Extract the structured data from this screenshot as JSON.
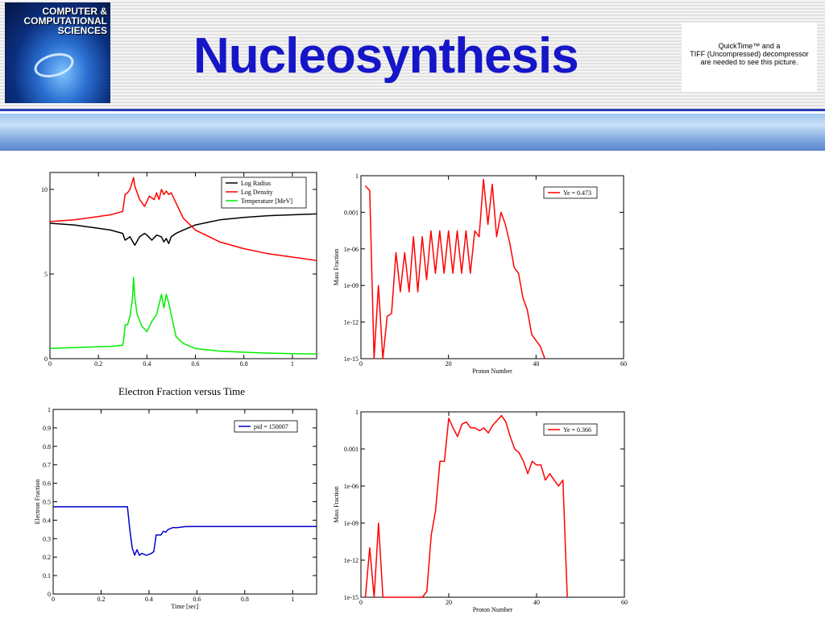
{
  "logo": {
    "lines": [
      "COMPUTER &",
      "COMPUTATIONAL",
      "SCIENCES"
    ]
  },
  "title": "Nucleosynthesis",
  "quicktime": {
    "lines": [
      "QuickTime™ and a",
      "TIFF (Uncompressed) decompressor",
      "are needed to see this picture."
    ]
  },
  "chart_data": [
    {
      "type": "line",
      "title": "",
      "xlabel": "",
      "ylabel": "",
      "xlim": [
        0,
        1.1
      ],
      "ylim": [
        0,
        11
      ],
      "x_ticks": [
        0,
        0.2,
        0.4,
        0.6,
        0.8,
        1
      ],
      "x_tick_labels": [
        "0",
        "0.2",
        "0.4",
        "0.6",
        "0.8",
        "1"
      ],
      "y_ticks": [
        0,
        5,
        10
      ],
      "y_tick_labels": [
        "0",
        "5",
        "10"
      ],
      "legend": "top-right",
      "series": [
        {
          "name": "Log Radius",
          "color": "#000000",
          "x": [
            0,
            0.1,
            0.2,
            0.25,
            0.3,
            0.31,
            0.32,
            0.33,
            0.35,
            0.37,
            0.39,
            0.4,
            0.42,
            0.44,
            0.46,
            0.47,
            0.48,
            0.49,
            0.5,
            0.52,
            0.55,
            0.6,
            0.7,
            0.8,
            0.9,
            1.0,
            1.1
          ],
          "y": [
            8.0,
            7.9,
            7.7,
            7.6,
            7.4,
            7.0,
            7.1,
            7.2,
            6.7,
            7.2,
            7.4,
            7.3,
            7.0,
            7.3,
            7.2,
            6.9,
            7.1,
            6.8,
            7.2,
            7.4,
            7.6,
            7.9,
            8.2,
            8.35,
            8.45,
            8.5,
            8.55
          ]
        },
        {
          "name": "Log Density",
          "color": "#ff0000",
          "x": [
            0,
            0.1,
            0.2,
            0.25,
            0.3,
            0.31,
            0.32,
            0.33,
            0.345,
            0.35,
            0.37,
            0.39,
            0.41,
            0.43,
            0.44,
            0.45,
            0.46,
            0.47,
            0.48,
            0.49,
            0.5,
            0.52,
            0.55,
            0.6,
            0.7,
            0.8,
            0.9,
            1.0,
            1.1
          ],
          "y": [
            8.1,
            8.2,
            8.4,
            8.5,
            8.7,
            9.7,
            9.8,
            10.0,
            10.7,
            10.2,
            9.4,
            9.0,
            9.6,
            9.4,
            9.8,
            9.4,
            10.0,
            9.7,
            9.9,
            9.7,
            9.8,
            9.2,
            8.3,
            7.6,
            6.9,
            6.5,
            6.2,
            6.0,
            5.8
          ]
        },
        {
          "name": "Temperature [MeV]",
          "color": "#00ee00",
          "x": [
            0,
            0.1,
            0.2,
            0.25,
            0.3,
            0.305,
            0.31,
            0.32,
            0.33,
            0.34,
            0.345,
            0.35,
            0.36,
            0.38,
            0.4,
            0.42,
            0.44,
            0.45,
            0.46,
            0.47,
            0.48,
            0.49,
            0.5,
            0.52,
            0.55,
            0.6,
            0.7,
            0.8,
            0.9,
            1.0,
            1.1
          ],
          "y": [
            0.6,
            0.65,
            0.7,
            0.72,
            0.8,
            1.2,
            2.0,
            2.0,
            2.5,
            3.5,
            4.8,
            3.6,
            2.6,
            1.9,
            1.6,
            2.2,
            2.6,
            3.2,
            3.8,
            3.0,
            3.8,
            3.3,
            2.6,
            1.3,
            0.9,
            0.6,
            0.45,
            0.38,
            0.33,
            0.3,
            0.27
          ]
        }
      ]
    },
    {
      "type": "line",
      "title": "",
      "xlabel": "Proton Number",
      "ylabel": "Mass Fraction",
      "xlim": [
        0,
        60
      ],
      "ylim": [
        1e-15,
        1
      ],
      "yscale": "log",
      "x_ticks": [
        0,
        20,
        40,
        60
      ],
      "x_tick_labels": [
        "0",
        "20",
        "40",
        "60"
      ],
      "y_ticks": [
        1e-15,
        1e-12,
        1e-09,
        1e-06,
        0.001,
        1
      ],
      "y_tick_labels": [
        "1e-15",
        "1e-12",
        "1e-09",
        "1e-06",
        "0.001",
        "1"
      ],
      "legend": "top-right",
      "series": [
        {
          "name": "Ye = 0.473",
          "color": "#ff0000",
          "x": [
            1,
            2,
            3,
            4,
            5,
            6,
            7,
            8,
            9,
            10,
            11,
            12,
            13,
            14,
            15,
            16,
            17,
            18,
            19,
            20,
            21,
            22,
            23,
            24,
            25,
            26,
            27,
            28,
            29,
            30,
            31,
            32,
            33,
            34,
            35,
            36,
            37,
            38,
            39,
            40,
            41,
            42
          ],
          "y": [
            0.15,
            0.06,
            1e-15,
            1e-09,
            1e-15,
            3e-12,
            5e-12,
            5e-07,
            3e-10,
            5e-07,
            3e-10,
            1e-05,
            3e-10,
            1e-05,
            3e-09,
            3e-05,
            1e-08,
            3e-05,
            1e-08,
            3e-05,
            1e-08,
            3e-05,
            1e-08,
            3e-05,
            1e-08,
            3e-05,
            1e-05,
            0.5,
            0.0001,
            0.2,
            1e-05,
            0.001,
            0.0001,
            3e-06,
            3e-08,
            1e-08,
            1e-10,
            1e-11,
            1e-13,
            3e-14,
            1e-14,
            1e-15
          ]
        }
      ]
    },
    {
      "type": "line",
      "title": "Electron Fraction versus Time",
      "xlabel": "Time [sec]",
      "ylabel": "Electron Fraction",
      "xlim": [
        0,
        1.1
      ],
      "ylim": [
        0,
        1
      ],
      "x_ticks": [
        0,
        0.2,
        0.4,
        0.6,
        0.8,
        1
      ],
      "x_tick_labels": [
        "0",
        "0.2",
        "0.4",
        "0.6",
        "0.8",
        "1"
      ],
      "y_ticks": [
        0,
        0.1,
        0.2,
        0.3,
        0.4,
        0.5,
        0.6,
        0.7,
        0.8,
        0.9,
        1
      ],
      "y_tick_labels": [
        "0",
        "0.1",
        "0.2",
        "0.3",
        "0.4",
        "0.5",
        "0.6",
        "0.7",
        "0.8",
        "0.9",
        "1"
      ],
      "legend": "top-right",
      "series": [
        {
          "name": "pid = 150007",
          "color": "#0000cc",
          "x": [
            0,
            0.2,
            0.3,
            0.31,
            0.32,
            0.33,
            0.34,
            0.35,
            0.36,
            0.37,
            0.38,
            0.39,
            0.4,
            0.41,
            0.42,
            0.43,
            0.45,
            0.46,
            0.47,
            0.48,
            0.5,
            0.52,
            0.55,
            0.6,
            0.7,
            0.8,
            1.0,
            1.1
          ],
          "y": [
            0.473,
            0.473,
            0.473,
            0.473,
            0.35,
            0.25,
            0.21,
            0.24,
            0.21,
            0.22,
            0.215,
            0.21,
            0.215,
            0.22,
            0.23,
            0.32,
            0.32,
            0.34,
            0.335,
            0.35,
            0.36,
            0.36,
            0.365,
            0.366,
            0.366,
            0.366,
            0.366,
            0.366
          ]
        }
      ]
    },
    {
      "type": "line",
      "title": "",
      "xlabel": "Proton Number",
      "ylabel": "Mass Fraction",
      "xlim": [
        0,
        60
      ],
      "ylim": [
        1e-15,
        1
      ],
      "yscale": "log",
      "x_ticks": [
        0,
        20,
        40,
        60
      ],
      "x_tick_labels": [
        "0",
        "20",
        "40",
        "60"
      ],
      "y_ticks": [
        1e-15,
        1e-12,
        1e-09,
        1e-06,
        0.001,
        1
      ],
      "y_tick_labels": [
        "1e-15",
        "1e-12",
        "1e-09",
        "1e-06",
        "0.001",
        "1"
      ],
      "legend": "top-right",
      "series": [
        {
          "name": "Ye = 0.366",
          "color": "#ff0000",
          "x": [
            1,
            2,
            3,
            4,
            5,
            14,
            15,
            16,
            17,
            18,
            19,
            20,
            21,
            22,
            23,
            24,
            25,
            26,
            27,
            28,
            29,
            30,
            31,
            32,
            33,
            34,
            35,
            36,
            37,
            38,
            39,
            40,
            41,
            42,
            43,
            44,
            45,
            46,
            47
          ],
          "y": [
            1e-15,
            1e-11,
            1e-15,
            1e-09,
            1e-15,
            1e-15,
            3e-15,
            1e-10,
            1e-08,
            0.0001,
            0.0001,
            0.3,
            0.05,
            0.01,
            0.1,
            0.15,
            0.05,
            0.05,
            0.03,
            0.05,
            0.02,
            0.08,
            0.2,
            0.5,
            0.15,
            0.01,
            0.001,
            0.0005,
            0.0001,
            1e-05,
            0.0001,
            5e-05,
            5e-05,
            3e-06,
            1e-05,
            3e-06,
            1e-06,
            3e-06,
            1e-15
          ]
        }
      ]
    }
  ]
}
